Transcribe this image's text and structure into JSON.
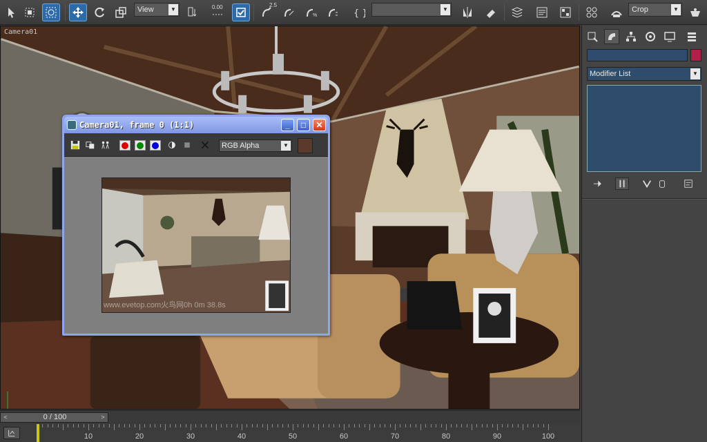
{
  "toolbar": {
    "reference_coord": "View",
    "named_selection": "",
    "render_output_mode": "Crop",
    "snap_label": "2.5",
    "spinner_snap": "0.00"
  },
  "viewport": {
    "label": "Camera01"
  },
  "frame_window": {
    "title": "Camera01, frame 0 (1:1)",
    "channel": "RGB Alpha",
    "watermark": "www.evetop.com火鸟网0h 0m 38.8s",
    "swatch_color": "#5a3a2a",
    "controls": [
      "minimize",
      "maximize",
      "close"
    ]
  },
  "command_panel": {
    "object_name": "",
    "modifier_list": "Modifier List",
    "object_color": "#b0204a"
  },
  "timeline": {
    "frame_label": "0 / 100",
    "ticks": [
      "10",
      "20",
      "30",
      "40",
      "50",
      "60",
      "70",
      "80",
      "90",
      "100"
    ]
  },
  "colors": {
    "accent": "#2d6aa8",
    "title_bar": "#8ea6ee",
    "panel_field": "#2e4c6b"
  }
}
